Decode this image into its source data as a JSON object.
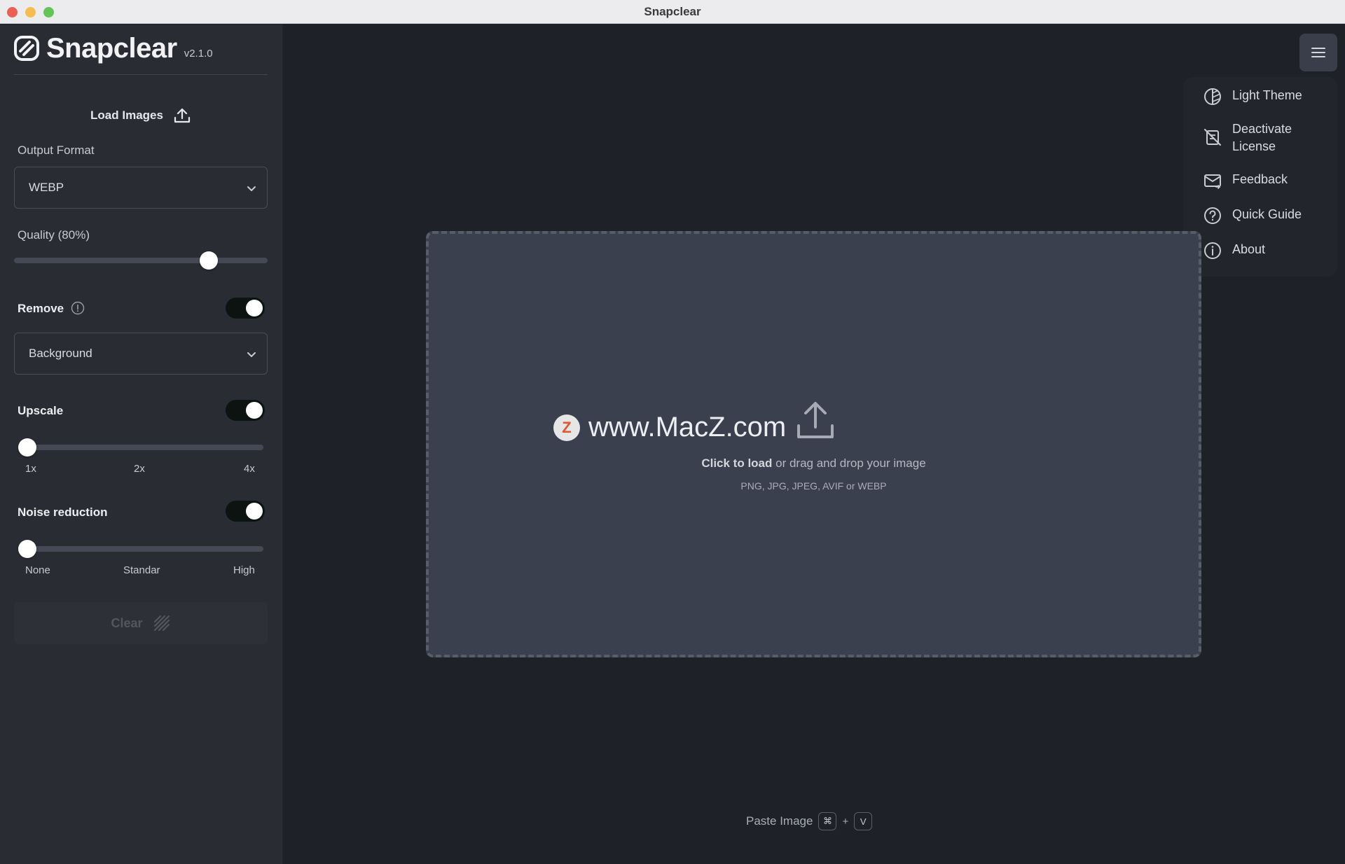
{
  "window": {
    "title": "Snapclear"
  },
  "sidebar": {
    "app_name": "Snapclear",
    "version": "v2.1.0",
    "load_images_label": "Load Images",
    "output_format": {
      "label": "Output Format",
      "value": "WEBP"
    },
    "quality": {
      "label": "Quality (80%)",
      "value_percent": 80
    },
    "remove": {
      "label": "Remove",
      "enabled": true,
      "value": "Background"
    },
    "upscale": {
      "label": "Upscale",
      "enabled": true,
      "ticks": [
        "1x",
        "2x",
        "4x"
      ],
      "value": "1x"
    },
    "noise_reduction": {
      "label": "Noise reduction",
      "enabled": true,
      "ticks": [
        "None",
        "Standar",
        "High"
      ],
      "value": "None"
    },
    "clear_label": "Clear"
  },
  "menu": {
    "items": [
      {
        "label": "Light Theme",
        "icon": "theme-icon"
      },
      {
        "label": "Deactivate License",
        "icon": "license-off-icon"
      },
      {
        "label": "Feedback",
        "icon": "mail-icon"
      },
      {
        "label": "Quick Guide",
        "icon": "help-icon"
      },
      {
        "label": "About",
        "icon": "info-icon"
      }
    ]
  },
  "dropzone": {
    "click_label": "Click to load",
    "rest_label": " or drag and drop your image",
    "formats": "PNG, JPG, JPEG, AVIF or WEBP"
  },
  "watermark": {
    "text": "www.MacZ.com",
    "logo_letter": "Z"
  },
  "paste": {
    "label": "Paste Image",
    "key1": "⌘",
    "plus": "+",
    "key2": "V"
  },
  "colors": {
    "sidebar_bg": "#2a2c33",
    "main_bg": "#1f2128",
    "dropzone_bg": "#3b404e"
  }
}
